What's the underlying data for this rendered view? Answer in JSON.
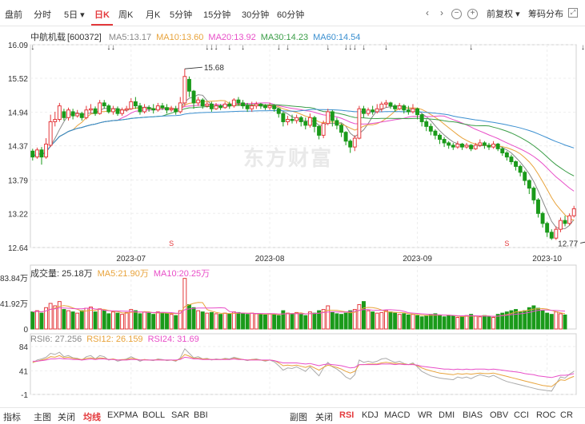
{
  "toolbar": {
    "tabs": [
      "盘前",
      "分时",
      "5日",
      "日K",
      "周K",
      "月K",
      "5分钟",
      "15分钟",
      "30分钟",
      "60分钟"
    ],
    "active": 3,
    "right": {
      "fq": "前复权",
      "chips": "筹码分布"
    }
  },
  "stock": {
    "name": "中航机载",
    "code": "[600372]"
  },
  "ma": [
    {
      "label": "MA5:13.17",
      "color": "#888888"
    },
    {
      "label": "MA10:13.60",
      "color": "#e8a33b"
    },
    {
      "label": "MA20:13.92",
      "color": "#e84ec8"
    },
    {
      "label": "MA30:14.23",
      "color": "#3a9d47"
    },
    {
      "label": "MA60:14.54",
      "color": "#3a8fd0"
    }
  ],
  "watermark": "东方财富",
  "vol_legend": [
    {
      "label": "成交量: 25.18万",
      "color": "#333333"
    },
    {
      "label": "MA5:21.90万",
      "color": "#e8a33b"
    },
    {
      "label": "MA10:20.25万",
      "color": "#e84ec8"
    }
  ],
  "rsi_legend": [
    {
      "label": "RSI6: 27.256",
      "color": "#888888"
    },
    {
      "label": "RSI12: 26.159",
      "color": "#e8a33b"
    },
    {
      "label": "RSI24: 31.69",
      "color": "#e84ec8"
    }
  ],
  "bottom": {
    "left": [
      "指标",
      "主图",
      "关闭",
      "均线",
      "EXPMA",
      "BOLL",
      "SAR",
      "BBI"
    ],
    "left_active": 3,
    "right": [
      "副图",
      "关闭",
      "RSI",
      "KDJ",
      "MACD",
      "WR",
      "DMI",
      "BIAS",
      "OBV",
      "CCI",
      "ROC",
      "CR"
    ],
    "right_active": 2
  },
  "chart_data": {
    "type": "candlestick",
    "price_axis": {
      "ticks": [
        "16.09",
        "15.52",
        "14.94",
        "14.37",
        "13.79",
        "13.22",
        "12.64"
      ],
      "ylim": [
        12.64,
        16.09
      ]
    },
    "vol_axis": {
      "ticks": [
        "83.84万",
        "41.92万",
        "0"
      ],
      "ylim": [
        0,
        83.84
      ]
    },
    "rsi_axis": {
      "ticks": [
        "84",
        "41",
        "-1"
      ],
      "ylim": [
        -1,
        84
      ]
    },
    "x_labels": [
      "2023-07",
      "2023-08",
      "2023-09",
      "2023-10"
    ],
    "x_label_index": [
      22,
      53,
      86,
      115
    ],
    "annotations": [
      {
        "text": "15.68",
        "index": 34,
        "value": 15.68
      },
      {
        "text": "12.77",
        "index": 126,
        "value": 12.77
      }
    ],
    "candles": [
      [
        14.28,
        14.18,
        14.32,
        14.12
      ],
      [
        14.18,
        14.3,
        14.34,
        14.15
      ],
      [
        14.3,
        14.18,
        14.35,
        14.05
      ],
      [
        14.18,
        14.4,
        14.5,
        14.15
      ],
      [
        14.38,
        14.78,
        14.9,
        14.35
      ],
      [
        14.78,
        14.82,
        14.95,
        14.7
      ],
      [
        14.82,
        15.05,
        15.1,
        14.78
      ],
      [
        14.95,
        14.85,
        15.0,
        14.8
      ],
      [
        14.85,
        14.98,
        15.02,
        14.8
      ],
      [
        14.95,
        14.88,
        15.0,
        14.82
      ],
      [
        14.88,
        14.92,
        14.98,
        14.85
      ],
      [
        14.92,
        14.85,
        14.95,
        14.8
      ],
      [
        14.85,
        14.98,
        15.05,
        14.82
      ],
      [
        14.98,
        15.0,
        15.08,
        14.92
      ],
      [
        15.0,
        14.92,
        15.04,
        14.88
      ],
      [
        14.92,
        15.1,
        15.15,
        14.9
      ],
      [
        15.1,
        15.05,
        15.15,
        15.0
      ],
      [
        15.05,
        14.95,
        15.08,
        14.92
      ],
      [
        14.95,
        15.0,
        15.05,
        14.9
      ],
      [
        15.0,
        14.92,
        15.04,
        14.88
      ],
      [
        14.92,
        14.98,
        15.02,
        14.88
      ],
      [
        14.98,
        15.0,
        15.05,
        14.95
      ],
      [
        15.0,
        15.12,
        15.18,
        14.98
      ],
      [
        15.12,
        15.05,
        15.2,
        15.0
      ],
      [
        15.05,
        14.95,
        15.1,
        14.9
      ],
      [
        14.95,
        15.02,
        15.08,
        14.92
      ],
      [
        15.02,
        15.0,
        15.06,
        14.95
      ],
      [
        15.0,
        14.98,
        15.08,
        14.92
      ],
      [
        14.98,
        15.05,
        15.1,
        14.95
      ],
      [
        15.05,
        15.02,
        15.1,
        14.98
      ],
      [
        15.02,
        14.98,
        15.08,
        14.92
      ],
      [
        14.98,
        15.0,
        15.05,
        14.95
      ],
      [
        15.0,
        14.95,
        15.05,
        14.9
      ],
      [
        14.95,
        15.1,
        15.2,
        14.92
      ],
      [
        15.1,
        15.55,
        15.68,
        15.05
      ],
      [
        15.5,
        15.3,
        15.55,
        15.2
      ],
      [
        15.3,
        15.1,
        15.32,
        15.0
      ],
      [
        15.1,
        15.15,
        15.2,
        15.05
      ],
      [
        15.15,
        15.05,
        15.18,
        15.0
      ],
      [
        15.05,
        15.08,
        15.12,
        15.02
      ],
      [
        15.08,
        15.0,
        15.12,
        14.95
      ],
      [
        15.0,
        15.05,
        15.1,
        14.98
      ],
      [
        15.05,
        15.02,
        15.08,
        14.98
      ],
      [
        15.02,
        15.08,
        15.12,
        15.0
      ],
      [
        15.08,
        15.05,
        15.12,
        15.0
      ],
      [
        15.05,
        15.15,
        15.18,
        15.02
      ],
      [
        15.15,
        15.1,
        15.2,
        15.05
      ],
      [
        15.1,
        15.05,
        15.15,
        15.0
      ],
      [
        15.05,
        15.0,
        15.1,
        14.95
      ],
      [
        15.0,
        15.05,
        15.12,
        14.95
      ],
      [
        15.05,
        15.08,
        15.12,
        15.0
      ],
      [
        15.08,
        15.05,
        15.1,
        15.0
      ],
      [
        15.05,
        15.02,
        15.08,
        14.98
      ],
      [
        15.02,
        15.05,
        15.1,
        14.98
      ],
      [
        15.05,
        15.0,
        15.08,
        14.95
      ],
      [
        15.0,
        14.92,
        15.02,
        14.85
      ],
      [
        14.92,
        14.78,
        14.95,
        14.7
      ],
      [
        14.78,
        14.82,
        14.88,
        14.72
      ],
      [
        14.82,
        14.8,
        14.9,
        14.75
      ],
      [
        14.8,
        14.85,
        14.9,
        14.75
      ],
      [
        14.85,
        14.78,
        14.88,
        14.7
      ],
      [
        14.78,
        14.72,
        14.85,
        14.65
      ],
      [
        14.72,
        14.85,
        14.92,
        14.68
      ],
      [
        14.85,
        14.7,
        14.88,
        14.6
      ],
      [
        14.7,
        14.55,
        14.72,
        14.48
      ],
      [
        14.55,
        14.75,
        14.8,
        14.5
      ],
      [
        14.75,
        14.95,
        15.0,
        14.72
      ],
      [
        14.95,
        14.8,
        14.98,
        14.7
      ],
      [
        14.8,
        14.72,
        14.85,
        14.65
      ],
      [
        14.72,
        14.6,
        14.75,
        14.52
      ],
      [
        14.6,
        14.45,
        14.62,
        14.38
      ],
      [
        14.45,
        14.35,
        14.48,
        14.25
      ],
      [
        14.35,
        14.5,
        14.55,
        14.28
      ],
      [
        14.5,
        15.0,
        15.05,
        14.48
      ],
      [
        15.0,
        14.92,
        15.05,
        14.85
      ],
      [
        14.92,
        14.98,
        15.02,
        14.88
      ],
      [
        14.98,
        14.95,
        15.05,
        14.9
      ],
      [
        14.95,
        15.0,
        15.08,
        14.92
      ],
      [
        15.0,
        15.08,
        15.12,
        14.95
      ],
      [
        15.08,
        15.1,
        15.15,
        15.02
      ],
      [
        15.1,
        15.05,
        15.12,
        15.0
      ],
      [
        15.05,
        15.0,
        15.08,
        14.95
      ],
      [
        15.0,
        15.05,
        15.1,
        14.98
      ],
      [
        15.05,
        14.98,
        15.08,
        14.92
      ],
      [
        14.98,
        14.95,
        15.05,
        14.9
      ],
      [
        14.95,
        15.0,
        15.08,
        14.92
      ],
      [
        15.0,
        14.9,
        15.02,
        14.82
      ],
      [
        14.9,
        14.78,
        14.92,
        14.7
      ],
      [
        14.78,
        14.7,
        14.82,
        14.62
      ],
      [
        14.7,
        14.62,
        14.75,
        14.55
      ],
      [
        14.62,
        14.55,
        14.65,
        14.48
      ],
      [
        14.55,
        14.48,
        14.58,
        14.4
      ],
      [
        14.48,
        14.42,
        14.52,
        14.35
      ],
      [
        14.42,
        14.38,
        14.45,
        14.32
      ],
      [
        14.38,
        14.35,
        14.42,
        14.3
      ],
      [
        14.35,
        14.4,
        14.45,
        14.32
      ],
      [
        14.4,
        14.35,
        14.42,
        14.3
      ],
      [
        14.35,
        14.38,
        14.42,
        14.32
      ],
      [
        14.38,
        14.32,
        14.4,
        14.28
      ],
      [
        14.32,
        14.38,
        14.42,
        14.3
      ],
      [
        14.38,
        14.42,
        14.48,
        14.35
      ],
      [
        14.42,
        14.38,
        14.45,
        14.32
      ],
      [
        14.38,
        14.35,
        14.42,
        14.3
      ],
      [
        14.35,
        14.4,
        14.45,
        14.32
      ],
      [
        14.4,
        14.32,
        14.42,
        14.28
      ],
      [
        14.32,
        14.25,
        14.35,
        14.2
      ],
      [
        14.25,
        14.18,
        14.28,
        14.12
      ],
      [
        14.18,
        14.1,
        14.22,
        14.05
      ],
      [
        14.1,
        14.02,
        14.12,
        13.95
      ],
      [
        14.02,
        13.92,
        14.05,
        13.85
      ],
      [
        13.92,
        13.78,
        13.95,
        13.7
      ],
      [
        13.78,
        13.65,
        13.8,
        13.55
      ],
      [
        13.65,
        13.45,
        13.68,
        13.38
      ],
      [
        13.45,
        13.22,
        13.48,
        13.15
      ],
      [
        13.22,
        13.05,
        13.25,
        12.98
      ],
      [
        13.05,
        12.9,
        13.08,
        12.82
      ],
      [
        12.9,
        12.8,
        12.95,
        12.77
      ],
      [
        12.8,
        12.95,
        13.0,
        12.77
      ],
      [
        12.95,
        13.1,
        13.15,
        12.9
      ],
      [
        13.1,
        13.05,
        13.18,
        13.0
      ],
      [
        13.05,
        13.18,
        13.22,
        13.02
      ],
      [
        13.18,
        13.3,
        13.35,
        13.15
      ]
    ],
    "volume": [
      28,
      30,
      26,
      35,
      42,
      38,
      45,
      32,
      30,
      28,
      26,
      30,
      34,
      36,
      28,
      33,
      30,
      25,
      28,
      26,
      24,
      27,
      32,
      30,
      25,
      28,
      26,
      24,
      28,
      27,
      25,
      24,
      22,
      30,
      83,
      40,
      35,
      30,
      28,
      26,
      27,
      25,
      24,
      26,
      25,
      28,
      27,
      25,
      24,
      26,
      25,
      24,
      23,
      25,
      24,
      22,
      30,
      26,
      25,
      27,
      24,
      22,
      28,
      26,
      30,
      32,
      38,
      28,
      25,
      24,
      26,
      30,
      32,
      40,
      45,
      30,
      28,
      26,
      27,
      30,
      28,
      26,
      24,
      25,
      23,
      24,
      22,
      20,
      22,
      24,
      25,
      23,
      20,
      22,
      21,
      19,
      20,
      22,
      24,
      21,
      20,
      22,
      20,
      19,
      24,
      26,
      28,
      30,
      32,
      28,
      30,
      35,
      38,
      34,
      30,
      26,
      24,
      28,
      25,
      23
    ],
    "rsi": [
      [
        55,
        56,
        58
      ],
      [
        60,
        58,
        58
      ],
      [
        62,
        60,
        59
      ],
      [
        65,
        62,
        60
      ],
      [
        72,
        66,
        62
      ],
      [
        70,
        65,
        62
      ],
      [
        74,
        68,
        63
      ],
      [
        66,
        64,
        62
      ],
      [
        68,
        65,
        62
      ],
      [
        64,
        63,
        61
      ],
      [
        63,
        62,
        61
      ],
      [
        60,
        61,
        60
      ],
      [
        66,
        63,
        61
      ],
      [
        68,
        64,
        62
      ],
      [
        62,
        62,
        61
      ],
      [
        68,
        64,
        62
      ],
      [
        66,
        63,
        62
      ],
      [
        60,
        61,
        61
      ],
      [
        62,
        62,
        61
      ],
      [
        58,
        60,
        60
      ],
      [
        60,
        61,
        60
      ],
      [
        62,
        61,
        60
      ],
      [
        66,
        63,
        61
      ],
      [
        62,
        62,
        61
      ],
      [
        58,
        60,
        60
      ],
      [
        61,
        61,
        60
      ],
      [
        60,
        60,
        60
      ],
      [
        59,
        60,
        60
      ],
      [
        62,
        61,
        60
      ],
      [
        61,
        60,
        60
      ],
      [
        59,
        60,
        60
      ],
      [
        60,
        60,
        60
      ],
      [
        58,
        59,
        60
      ],
      [
        64,
        62,
        61
      ],
      [
        80,
        70,
        65
      ],
      [
        72,
        67,
        64
      ],
      [
        64,
        63,
        62
      ],
      [
        66,
        63,
        62
      ],
      [
        62,
        62,
        61
      ],
      [
        63,
        62,
        61
      ],
      [
        60,
        61,
        61
      ],
      [
        62,
        61,
        61
      ],
      [
        61,
        61,
        61
      ],
      [
        63,
        62,
        61
      ],
      [
        62,
        61,
        61
      ],
      [
        65,
        63,
        62
      ],
      [
        63,
        62,
        61
      ],
      [
        61,
        61,
        61
      ],
      [
        59,
        60,
        60
      ],
      [
        61,
        61,
        60
      ],
      [
        62,
        61,
        60
      ],
      [
        60,
        60,
        60
      ],
      [
        58,
        59,
        60
      ],
      [
        60,
        60,
        60
      ],
      [
        57,
        59,
        59
      ],
      [
        50,
        55,
        57
      ],
      [
        42,
        50,
        55
      ],
      [
        46,
        51,
        55
      ],
      [
        45,
        50,
        55
      ],
      [
        48,
        51,
        55
      ],
      [
        44,
        49,
        54
      ],
      [
        40,
        47,
        53
      ],
      [
        48,
        50,
        54
      ],
      [
        40,
        46,
        52
      ],
      [
        32,
        42,
        50
      ],
      [
        46,
        47,
        52
      ],
      [
        56,
        51,
        53
      ],
      [
        48,
        49,
        52
      ],
      [
        44,
        47,
        51
      ],
      [
        38,
        44,
        50
      ],
      [
        30,
        40,
        48
      ],
      [
        26,
        37,
        46
      ],
      [
        34,
        40,
        47
      ],
      [
        60,
        52,
        52
      ],
      [
        56,
        52,
        52
      ],
      [
        58,
        53,
        52
      ],
      [
        56,
        53,
        52
      ],
      [
        58,
        53,
        52
      ],
      [
        62,
        55,
        53
      ],
      [
        63,
        56,
        53
      ],
      [
        59,
        55,
        53
      ],
      [
        56,
        54,
        52
      ],
      [
        58,
        54,
        53
      ],
      [
        54,
        53,
        52
      ],
      [
        52,
        52,
        52
      ],
      [
        55,
        53,
        52
      ],
      [
        48,
        50,
        51
      ],
      [
        40,
        46,
        49
      ],
      [
        36,
        43,
        48
      ],
      [
        32,
        41,
        47
      ],
      [
        30,
        39,
        46
      ],
      [
        28,
        37,
        45
      ],
      [
        27,
        36,
        44
      ],
      [
        26,
        35,
        44
      ],
      [
        25,
        34,
        43
      ],
      [
        30,
        36,
        44
      ],
      [
        28,
        35,
        43
      ],
      [
        30,
        36,
        44
      ],
      [
        27,
        35,
        43
      ],
      [
        31,
        36,
        44
      ],
      [
        34,
        37,
        44
      ],
      [
        32,
        36,
        44
      ],
      [
        30,
        36,
        43
      ],
      [
        33,
        37,
        44
      ],
      [
        29,
        35,
        43
      ],
      [
        25,
        33,
        42
      ],
      [
        22,
        31,
        41
      ],
      [
        20,
        29,
        40
      ],
      [
        18,
        27,
        39
      ],
      [
        16,
        25,
        38
      ],
      [
        14,
        23,
        36
      ],
      [
        12,
        21,
        35
      ],
      [
        10,
        19,
        34
      ],
      [
        8,
        17,
        32
      ],
      [
        7,
        15,
        31
      ],
      [
        6,
        14,
        30
      ],
      [
        5,
        13,
        29
      ],
      [
        18,
        19,
        31
      ],
      [
        30,
        25,
        33
      ],
      [
        28,
        24,
        33
      ],
      [
        35,
        28,
        34
      ],
      [
        40,
        31,
        36
      ]
    ]
  }
}
